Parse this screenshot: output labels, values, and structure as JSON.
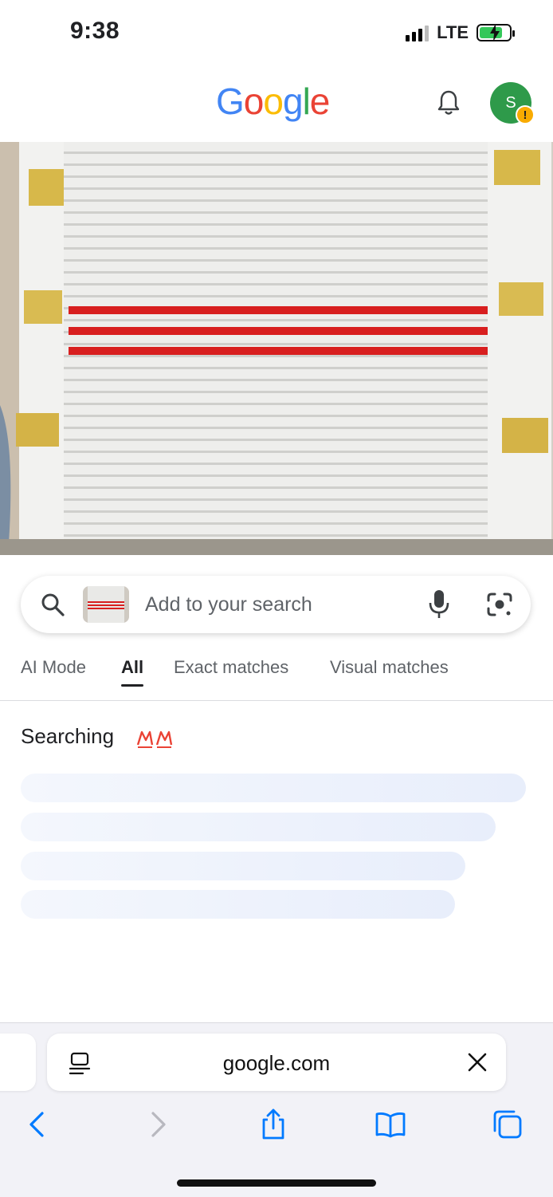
{
  "status_bar": {
    "time": "9:38",
    "network": "LTE",
    "battery_icon": "battery-charging-icon",
    "colors": {
      "battery": "#34c759"
    }
  },
  "header": {
    "logo_letters": [
      {
        "ch": "G",
        "color": "#4285F4"
      },
      {
        "ch": "o",
        "color": "#EA4335"
      },
      {
        "ch": "o",
        "color": "#FBBC05"
      },
      {
        "ch": "g",
        "color": "#4285F4"
      },
      {
        "ch": "l",
        "color": "#34A853"
      },
      {
        "ch": "e",
        "color": "#EA4335"
      }
    ],
    "bell_icon": "bell-icon",
    "avatar_initial": "S",
    "avatar_color": "#2e9a4a",
    "warning_badge": "!"
  },
  "search": {
    "placeholder": "Add to your search",
    "icons": [
      "search-icon",
      "mic-icon",
      "google-lens-icon"
    ]
  },
  "tabs": [
    {
      "label": "AI Mode",
      "active": false
    },
    {
      "label": "All",
      "active": true
    },
    {
      "label": "Exact matches",
      "active": false
    },
    {
      "label": "Visual matches",
      "active": false
    }
  ],
  "results": {
    "status_text": "Searching"
  },
  "browser": {
    "url": "google.com",
    "nav_icons": [
      "back-icon",
      "forward-icon",
      "share-icon",
      "bookmarks-icon",
      "tabs-icon"
    ],
    "accent": "#007aff"
  }
}
